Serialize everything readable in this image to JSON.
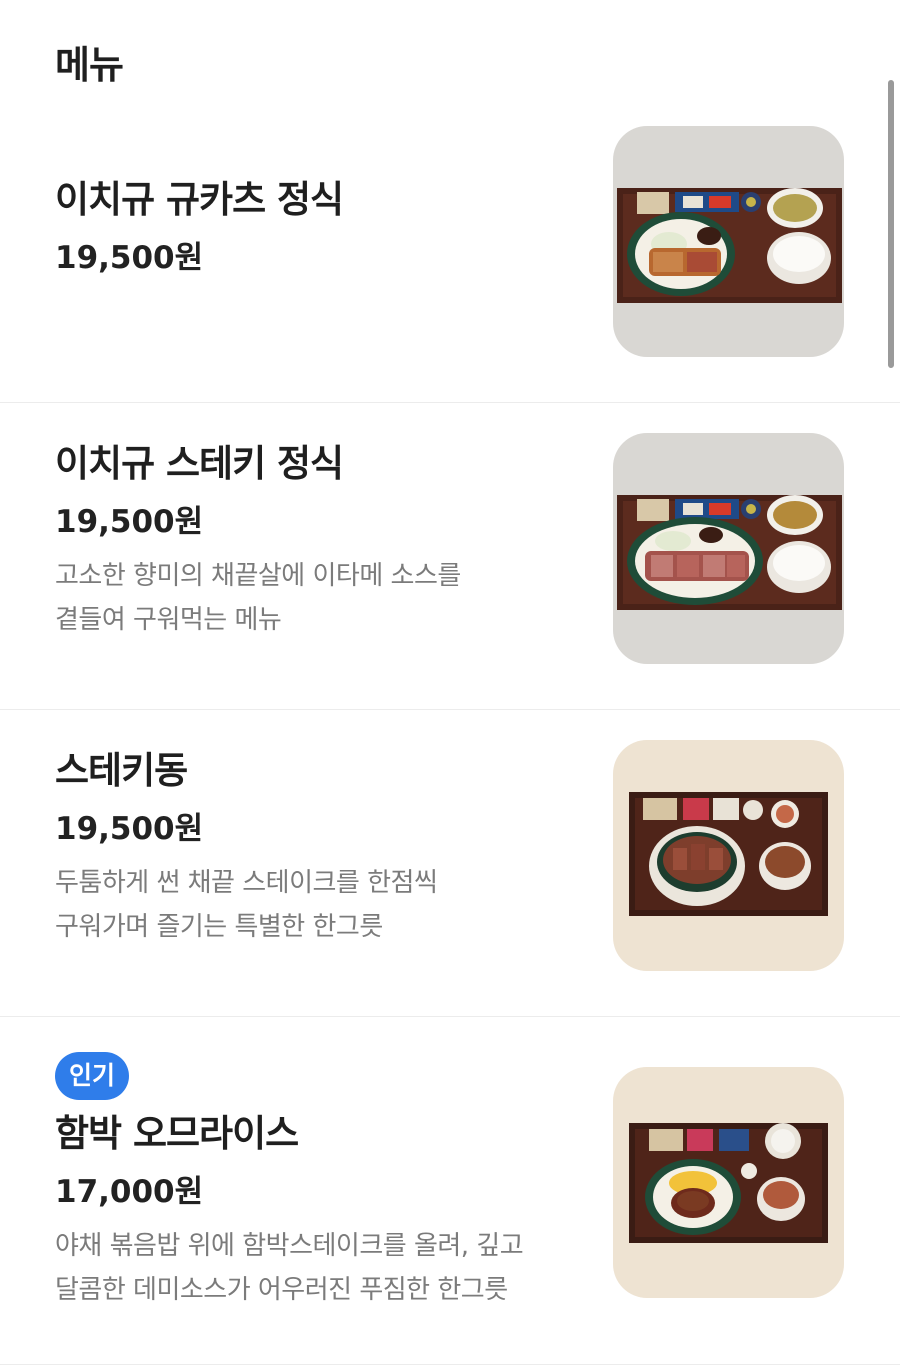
{
  "menu_section": {
    "title": "메뉴"
  },
  "items": [
    {
      "name": "이치규 규카츠 정식",
      "price": "19,500원",
      "description": "",
      "badge": "",
      "image_icon": "gyukatsu-set-photo"
    },
    {
      "name": "이치규 스테키 정식",
      "price": "19,500원",
      "description": "고소한 향미의 채끝살에 이타메 소스를\n곁들여 구워먹는 메뉴",
      "badge": "",
      "image_icon": "steak-set-photo"
    },
    {
      "name": "스테키동",
      "price": "19,500원",
      "description": "두툼하게 썬 채끝 스테이크를 한점씩\n구워가며 즐기는 특별한 한그릇",
      "badge": "",
      "image_icon": "steak-don-photo"
    },
    {
      "name": "함박 오므라이스",
      "price": "17,000원",
      "description": "야채 볶음밥 위에 함박스테이크를 올려, 깊고\n달콤한 데미소스가 어우러진 푸짐한 한그릇",
      "badge": "인기",
      "image_icon": "hamburg-omurice-photo"
    }
  ],
  "colors": {
    "badge": "#2f7dea",
    "price": "#222222",
    "description": "#7b7b7b",
    "divider": "#ececec"
  }
}
